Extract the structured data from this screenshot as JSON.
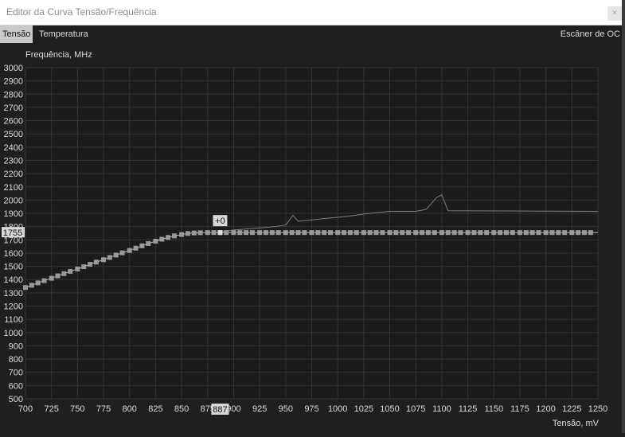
{
  "window": {
    "title": "Editor da Curva Tensão/Frequência",
    "close_label": "×"
  },
  "tabs": [
    {
      "label": "Tensão",
      "active": true
    },
    {
      "label": "Temperatura",
      "active": false
    }
  ],
  "scanner_label": "Escâner de OC",
  "colors": {
    "background": "#1f1f1f",
    "grid": "#333333",
    "curve": "#7d7d7d",
    "points": "#9a9a9a",
    "selected_point": "#e0e0e0",
    "text": "#dcdcdc"
  },
  "chart_data": {
    "type": "line",
    "ylabel": "Frequência, MHz",
    "xlabel": "Tensão, mV",
    "xlim": [
      700,
      1250
    ],
    "ylim": [
      500,
      3000
    ],
    "x_ticks": [
      700,
      725,
      750,
      775,
      800,
      825,
      850,
      875,
      900,
      925,
      950,
      975,
      1000,
      1025,
      1050,
      1075,
      1100,
      1125,
      1150,
      1175,
      1200,
      1225,
      1250
    ],
    "x_tick_labels": [
      "700",
      "725",
      "750",
      "775",
      "800",
      "825",
      "850",
      "875",
      "900",
      "925",
      "950",
      "975",
      "1000",
      "1025",
      "1050",
      "1075",
      "1100",
      "1125",
      "1150",
      "1175",
      "1200",
      "1225",
      "1250"
    ],
    "y_ticks": [
      500,
      600,
      700,
      800,
      900,
      1000,
      1100,
      1200,
      1300,
      1400,
      1500,
      1600,
      1700,
      1800,
      1900,
      2000,
      2100,
      2200,
      2300,
      2400,
      2500,
      2600,
      2700,
      2800,
      2900,
      3000
    ],
    "y_tick_labels": [
      "500",
      "600",
      "700",
      "800",
      "900",
      "1000",
      "1100",
      "1200",
      "1300",
      "1400",
      "1500",
      "1600",
      "1700",
      "1800",
      "1900",
      "2000",
      "2100",
      "2200",
      "2300",
      "2400",
      "2500",
      "2600",
      "2700",
      "2800",
      "2900",
      "3000"
    ],
    "grid": true,
    "selected_point": {
      "x": 887,
      "y": 1755,
      "x_label": "887",
      "y_label": "1755",
      "offset_label": "+0"
    },
    "series": [
      {
        "role": "default-curve",
        "x": [
          887,
          900,
          925,
          940,
          950,
          957,
          962,
          975,
          985,
          1000,
          1012,
          1025,
          1037,
          1050,
          1075,
          1085,
          1090,
          1095,
          1100,
          1106,
          1250
        ],
        "y": [
          1760,
          1775,
          1790,
          1800,
          1812,
          1885,
          1840,
          1850,
          1860,
          1870,
          1880,
          1895,
          1905,
          1915,
          1915,
          1930,
          1975,
          2020,
          2040,
          1920,
          1915
        ]
      },
      {
        "role": "adjusted-points",
        "x": [
          700,
          706,
          712,
          718,
          725,
          731,
          737,
          743,
          750,
          756,
          762,
          768,
          775,
          781,
          787,
          793,
          800,
          806,
          812,
          818,
          825,
          831,
          837,
          843,
          850,
          856,
          862,
          868,
          875,
          881,
          887,
          893,
          900,
          906,
          912,
          918,
          925,
          931,
          937,
          943,
          950,
          956,
          962,
          968,
          975,
          981,
          987,
          993,
          1000,
          1006,
          1012,
          1018,
          1025,
          1031,
          1037,
          1043,
          1050,
          1056,
          1062,
          1068,
          1075,
          1081,
          1087,
          1093,
          1100,
          1106,
          1112,
          1118,
          1125,
          1131,
          1137,
          1143,
          1150,
          1156,
          1162,
          1168,
          1175,
          1181,
          1187,
          1193,
          1200,
          1206,
          1212,
          1218,
          1225,
          1231,
          1237,
          1243
        ],
        "y": [
          1340,
          1357,
          1375,
          1392,
          1410,
          1428,
          1445,
          1462,
          1480,
          1497,
          1515,
          1532,
          1550,
          1567,
          1585,
          1602,
          1620,
          1637,
          1655,
          1672,
          1690,
          1705,
          1718,
          1730,
          1740,
          1748,
          1752,
          1754,
          1755,
          1755,
          1755,
          1755,
          1755,
          1755,
          1755,
          1755,
          1755,
          1755,
          1755,
          1755,
          1755,
          1755,
          1755,
          1755,
          1755,
          1755,
          1755,
          1755,
          1755,
          1755,
          1755,
          1755,
          1755,
          1755,
          1755,
          1755,
          1755,
          1755,
          1755,
          1755,
          1755,
          1755,
          1755,
          1755,
          1755,
          1755,
          1755,
          1755,
          1755,
          1755,
          1755,
          1755,
          1755,
          1755,
          1755,
          1755,
          1755,
          1755,
          1755,
          1755,
          1755,
          1755,
          1755,
          1755,
          1755,
          1755,
          1755,
          1755
        ]
      }
    ]
  }
}
